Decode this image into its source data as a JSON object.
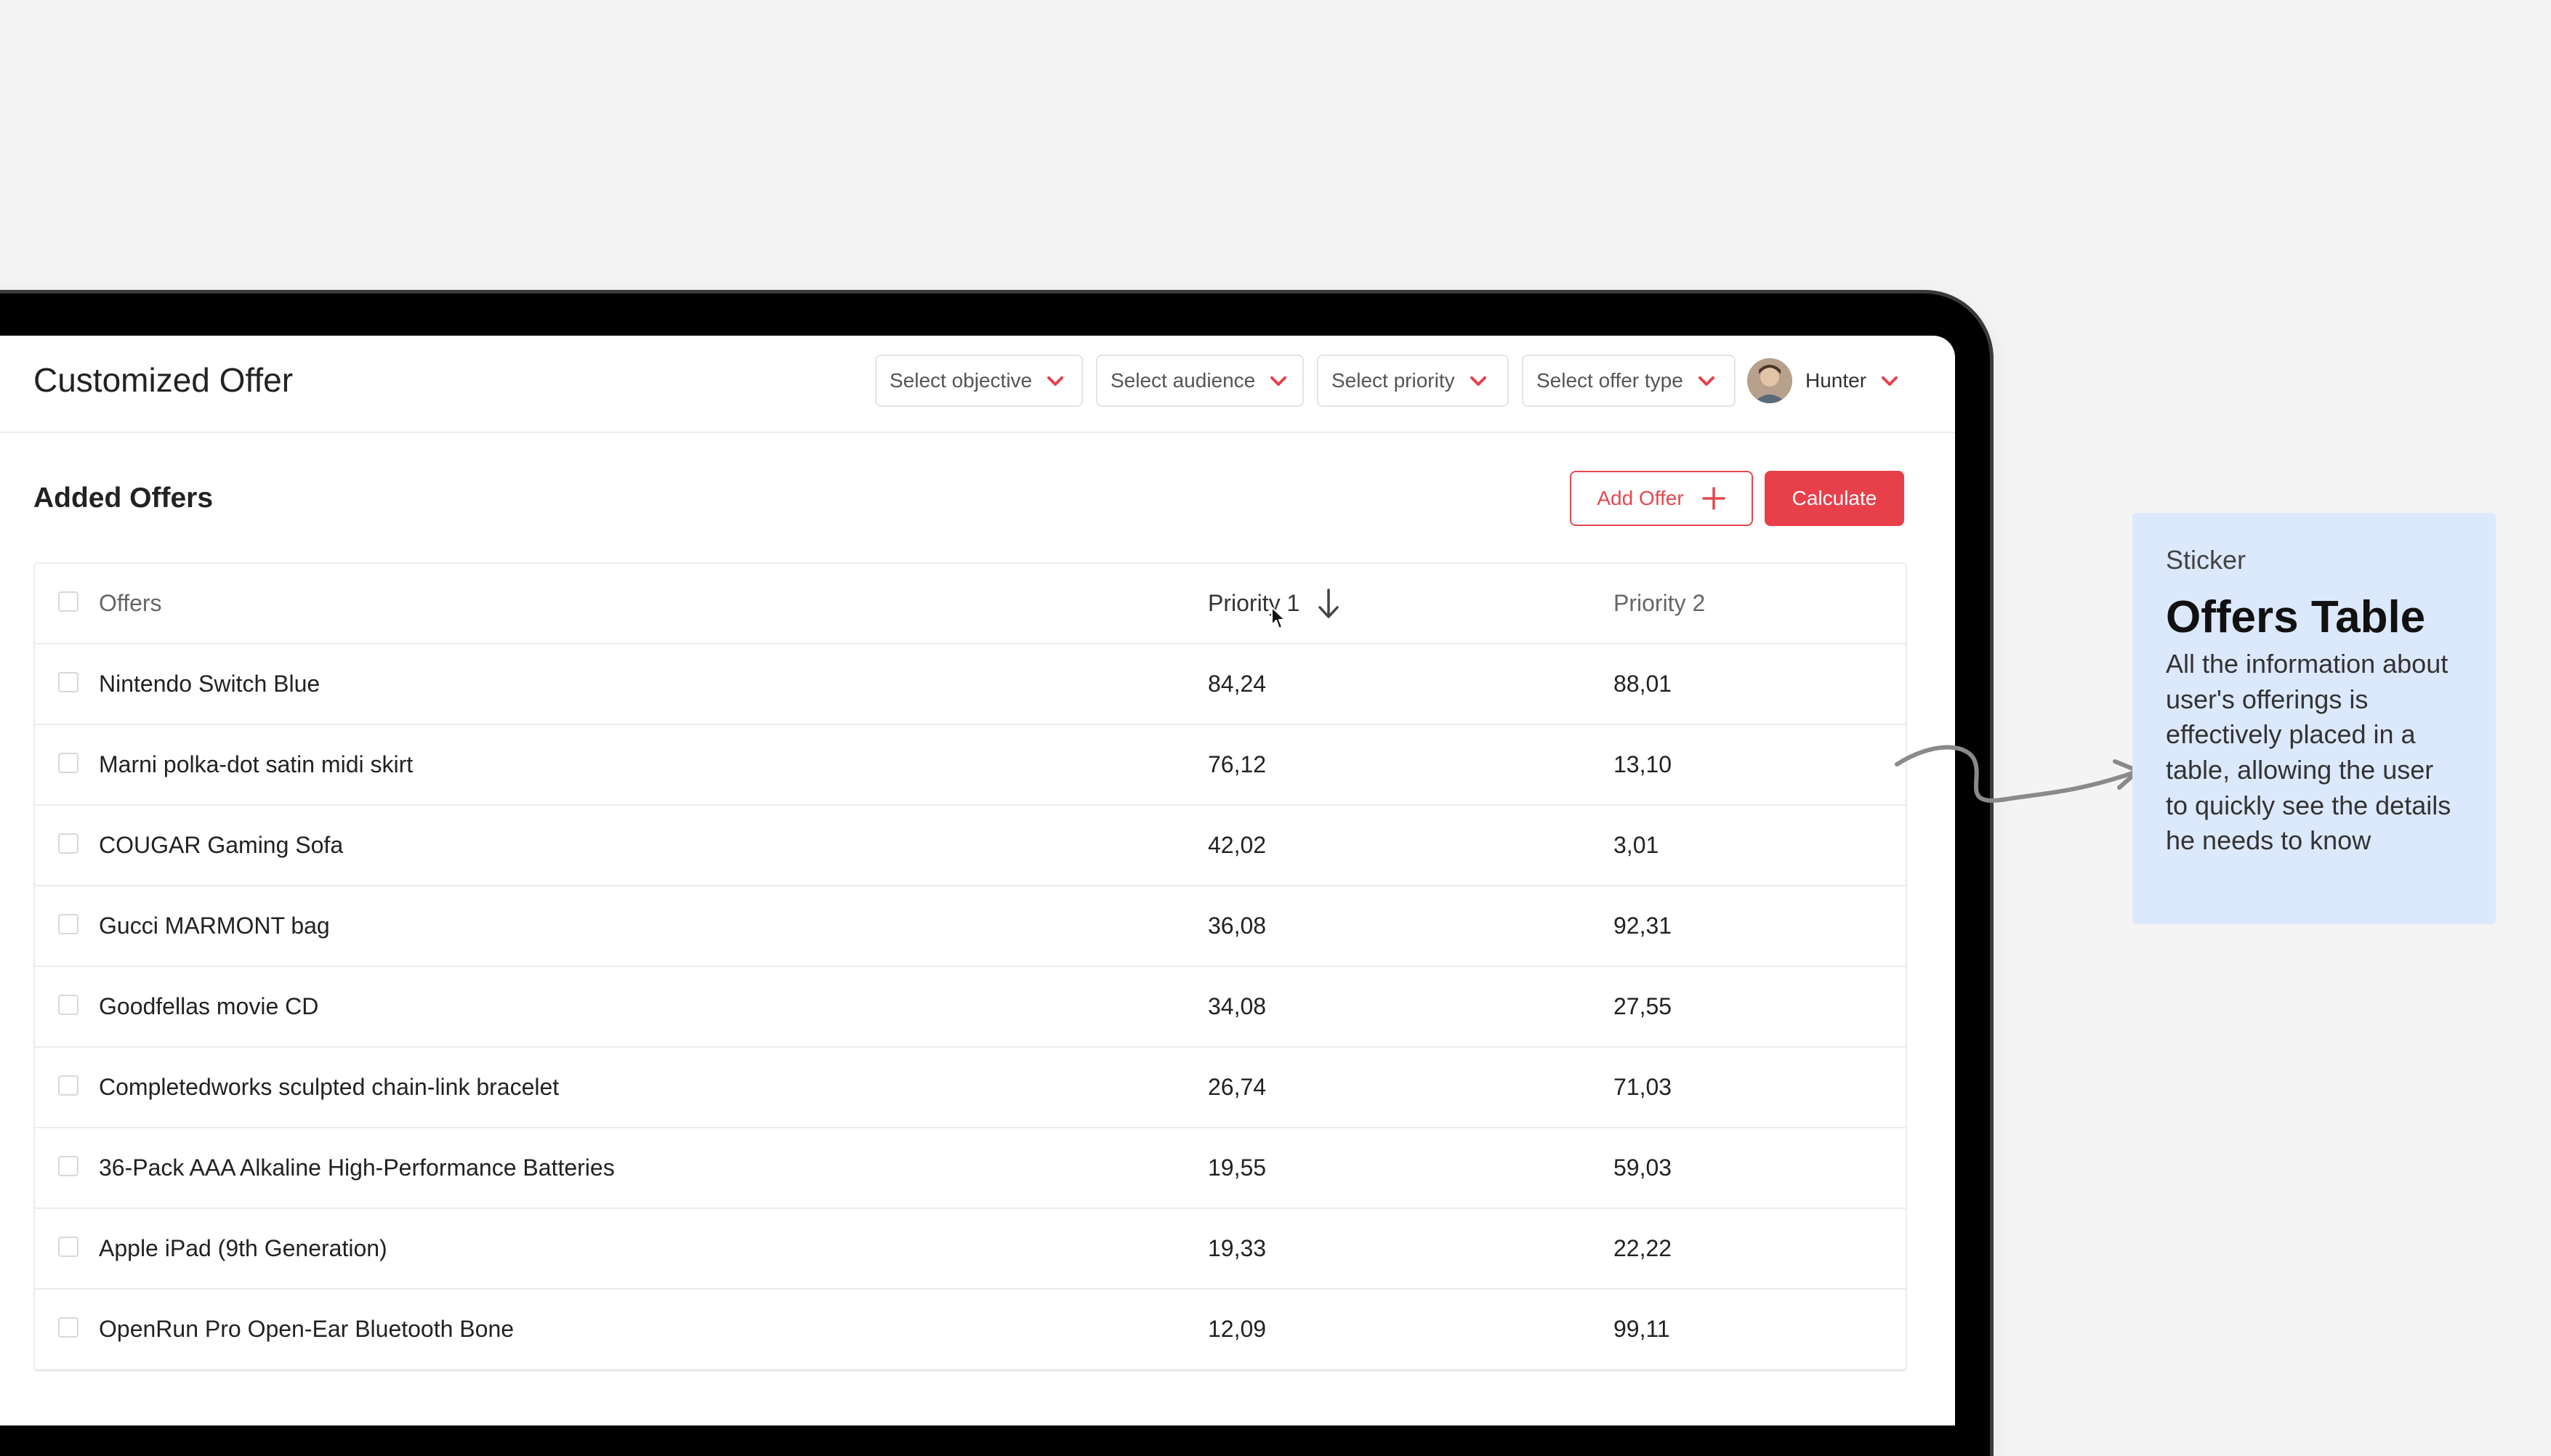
{
  "header": {
    "title": "Customized Offer",
    "filters": [
      {
        "label": "Select objective"
      },
      {
        "label": "Select audience"
      },
      {
        "label": "Select priority"
      },
      {
        "label": "Select offer type"
      }
    ],
    "user": {
      "name": "Hunter"
    }
  },
  "section": {
    "title": "Added Offers",
    "add_button": "Add Offer",
    "calculate_button": "Calculate"
  },
  "table": {
    "columns": [
      "Offers",
      "Priority 1",
      "Priority 2"
    ],
    "rows": [
      {
        "offer": "Nintendo Switch Blue",
        "p1": "84,24",
        "p2": "88,01"
      },
      {
        "offer": "Marni polka-dot satin midi skirt",
        "p1": "76,12",
        "p2": "13,10"
      },
      {
        "offer": "COUGAR Gaming Sofa",
        "p1": "42,02",
        "p2": "3,01"
      },
      {
        "offer": "Gucci MARMONT bag",
        "p1": "36,08",
        "p2": "92,31"
      },
      {
        "offer": "Goodfellas movie CD",
        "p1": "34,08",
        "p2": "27,55"
      },
      {
        "offer": "Completedworks sculpted chain-link bracelet",
        "p1": "26,74",
        "p2": "71,03"
      },
      {
        "offer": "36-Pack AAA Alkaline High-Performance Batteries",
        "p1": "19,55",
        "p2": "59,03"
      },
      {
        "offer": "Apple iPad (9th Generation)",
        "p1": "19,33",
        "p2": "22,22"
      },
      {
        "offer": "OpenRun Pro Open-Ear Bluetooth Bone",
        "p1": "12,09",
        "p2": "99,11"
      }
    ]
  },
  "sticker": {
    "kicker": "Sticker",
    "title": "Offers Table",
    "body": "All the information about user's offerings is effectively placed in a table, allowing the user to quickly see the details he needs to know"
  },
  "colors": {
    "accent": "#e8404a",
    "sticker_bg": "#dce8fb"
  }
}
